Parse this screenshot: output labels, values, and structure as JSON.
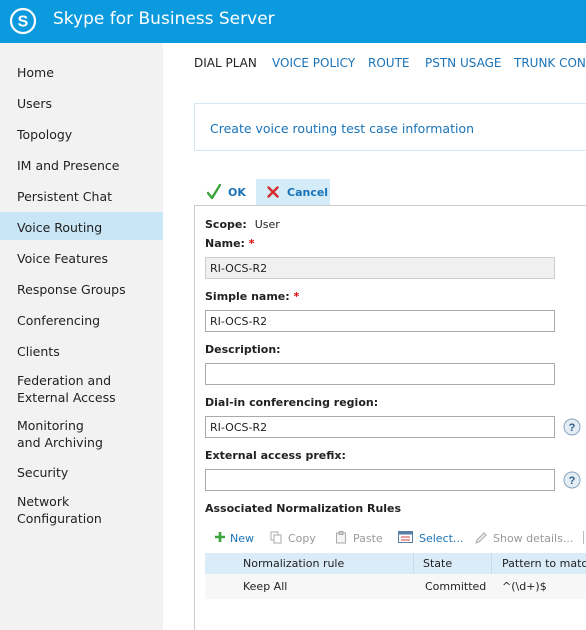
{
  "header": {
    "title": "Skype for Business Server",
    "background": "#0b9ade"
  },
  "sidebar": {
    "items": [
      {
        "label": "Home"
      },
      {
        "label": "Users"
      },
      {
        "label": "Topology"
      },
      {
        "label": "IM and Presence"
      },
      {
        "label": "Persistent Chat"
      },
      {
        "label": "Voice Routing",
        "active": true
      },
      {
        "label": "Voice Features"
      },
      {
        "label": "Response Groups"
      },
      {
        "label": "Conferencing"
      },
      {
        "label": "Clients"
      },
      {
        "label_line1": "Federation and",
        "label_line2": "External Access"
      },
      {
        "label_line1": "Monitoring",
        "label_line2": "and Archiving"
      },
      {
        "label": "Security"
      },
      {
        "label_line1": "Network",
        "label_line2": "Configuration"
      }
    ]
  },
  "tabs": [
    "DIAL PLAN",
    "VOICE POLICY",
    "ROUTE",
    "PSTN USAGE",
    "TRUNK CONF"
  ],
  "banner": {
    "text": "Create voice routing test case information"
  },
  "actions": {
    "ok_label": "OK",
    "cancel_label": "Cancel"
  },
  "form": {
    "scope_label": "Scope:",
    "scope_value": "User",
    "name_label": "Name:",
    "name_value": "RI-OCS-R2",
    "simple_name_label": "Simple name:",
    "simple_name_value": "RI-OCS-R2",
    "description_label": "Description:",
    "description_value": "",
    "dialin_label": "Dial-in conferencing region:",
    "dialin_value": "RI-OCS-R2",
    "external_prefix_label": "External access prefix:",
    "external_prefix_value": "",
    "required_mark": "*"
  },
  "rules": {
    "title": "Associated Normalization Rules",
    "toolbar": {
      "new": "New",
      "copy": "Copy",
      "paste": "Paste",
      "select": "Select...",
      "show_details": "Show details..."
    },
    "columns": [
      "Normalization rule",
      "State",
      "Pattern to match"
    ],
    "rows": [
      {
        "rule": "Keep All",
        "state": "Committed",
        "pattern": "^(\\d+)$"
      }
    ]
  }
}
